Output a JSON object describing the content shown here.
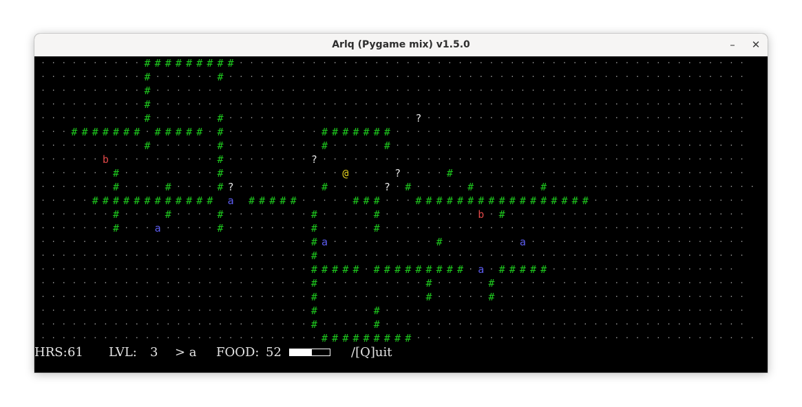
{
  "window": {
    "title": "Arlq (Pygame mix) v1.5.0",
    "minimize_glyph": "–",
    "close_glyph": "✕"
  },
  "colors": {
    "wall": "#1ec81e",
    "floor": "#9a9a9a",
    "player": "#e6d21e",
    "enemy_a": "#5c5cf0",
    "enemy_b": "#e04848",
    "item": "#e6e6e6",
    "background": "#000000"
  },
  "map": {
    "cols": 70,
    "rows": 21,
    "rows_text": [
      "..........#########.................................................",
      "..........#......#..................................................",
      "..........#.........................................................",
      "..........#.........................................................",
      "..........#......#..................?...............................",
      "...#######.#####.#.........#######..................................",
      "..........#......#.........#.....#..................................",
      "......b..........#........?.........................................",
      ".......#.........#...........@....?....#............................",
      ".......#....#....#?........#.....?.#.....#......#....................",
      ".....############ a #####.....###...#################...............",
      ".......#....#....#........#.....#.........b.#.......................",
      ".......#...a.....#........#.....#...................................",
      "..........................#a..........#.......a.....................",
      "..........................#.........................................",
      "..........................#####.#########.a.#####..................",
      "..........................#..........#.....#........................",
      "..........................#..........#.....#........................",
      "..........................#.....#...................................",
      "..........................#.....#...................................",
      "...........................#########................................."
    ]
  },
  "status": {
    "hrs_label": "HRS:",
    "hrs_value": "61",
    "lvl_label": "LVL:",
    "lvl_value": "3",
    "prompt": "> a",
    "food_label": "FOOD:",
    "food_value": "52",
    "food_fraction": 0.55,
    "quit_label": "/[Q]uit"
  }
}
